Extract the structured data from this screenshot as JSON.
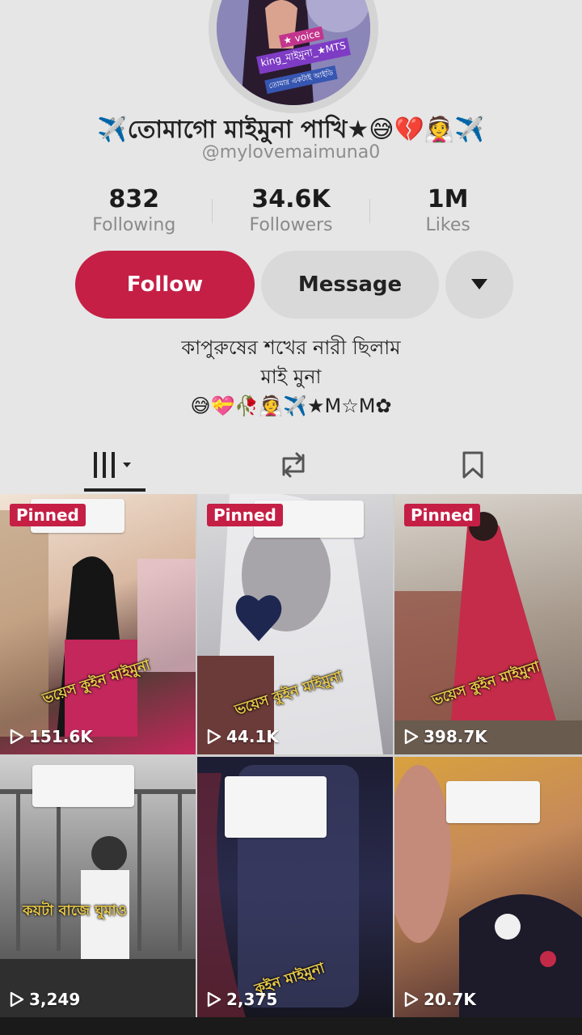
{
  "profile": {
    "avatar_tags": [
      "★ voice",
      "king_মাইমুনা_★MTS",
      "তোমার একটাই আইডি"
    ],
    "display_name": "✈️তোমাগো মাইমুনা পাখি★😅💔👰✈️",
    "username": "@mylovemaimuna0",
    "stats": [
      {
        "value": "832",
        "label": "Following"
      },
      {
        "value": "34.6K",
        "label": "Followers"
      },
      {
        "value": "1M",
        "label": "Likes"
      }
    ],
    "follow_label": "Follow",
    "message_label": "Message",
    "bio_line1": "কাপুরুষের শখের নারী ছিলাম",
    "bio_line2": "মাই মুনা",
    "bio_line3": "😅💝🥀👰✈️★M☆M✿"
  },
  "colors": {
    "accent": "#c51f46",
    "background": "#e6e6e6"
  },
  "tabs": [
    {
      "name": "videos",
      "icon": "grid-icon"
    },
    {
      "name": "reposts",
      "icon": "repost-icon"
    },
    {
      "name": "saved",
      "icon": "bookmark-icon"
    }
  ],
  "videos": [
    {
      "pinned": "Pinned",
      "views": "151.6K",
      "caption": "ভয়েস কুইন মাইমুনা"
    },
    {
      "pinned": "Pinned",
      "views": "44.1K",
      "caption": "ভয়েস কুইন মাইমুনা"
    },
    {
      "pinned": "Pinned",
      "views": "398.7K",
      "caption": "ভয়েস কুইন মাইমুনা"
    },
    {
      "pinned": "",
      "views": "3,249",
      "caption": "কয়টা বাজে ঘুমাও"
    },
    {
      "pinned": "",
      "views": "2,375",
      "caption": "কুইন মাইমুনা"
    },
    {
      "pinned": "",
      "views": "20.7K",
      "caption": ""
    }
  ]
}
